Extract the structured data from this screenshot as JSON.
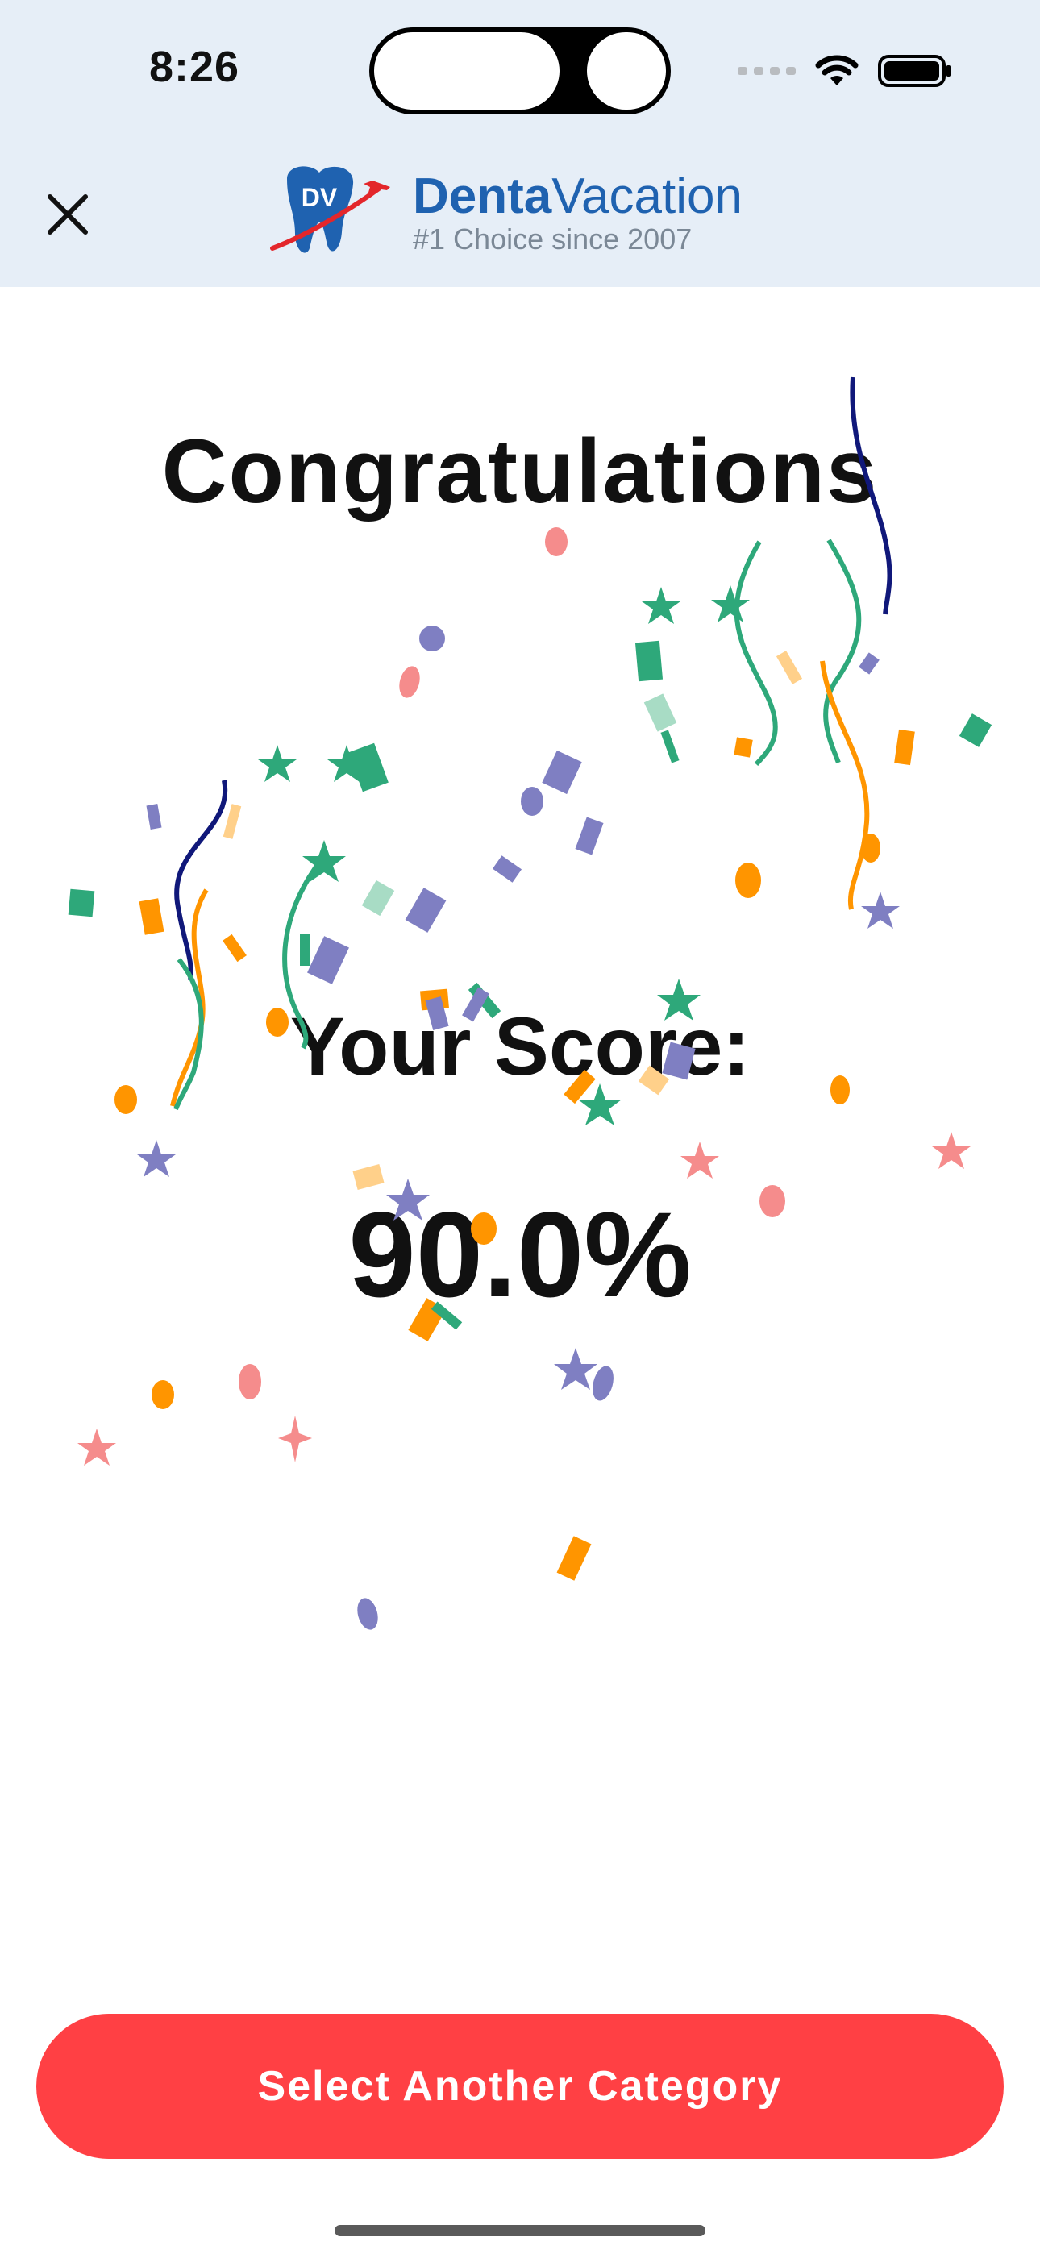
{
  "status_bar": {
    "time": "8:26"
  },
  "header": {
    "brand_name_bold": "Denta",
    "brand_name_light": "Vacation",
    "brand_tagline": "#1 Choice since 2007",
    "logo_initials": "DV",
    "close_icon": "close-icon"
  },
  "main": {
    "title": "Congratulations",
    "score_label": "Your Score:",
    "score_value": "90.0%"
  },
  "footer": {
    "button_label": "Select Another Category"
  },
  "colors": {
    "header_bg": "#e6eef7",
    "brand_blue": "#1f62b0",
    "button_red": "#ff4044",
    "confetti_green": "#2ea87a",
    "confetti_orange": "#ff9500",
    "confetti_purple": "#7f7fc2",
    "confetti_pink": "#f58c8c",
    "confetti_navy": "#10187a"
  }
}
